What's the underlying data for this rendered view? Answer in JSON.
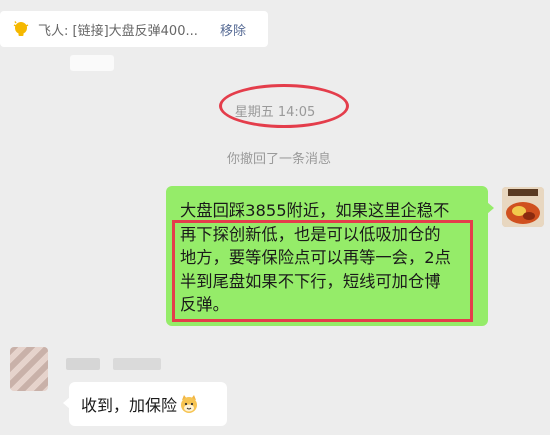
{
  "quote": {
    "icon": "lightbulb-icon",
    "text": "飞人: [链接]大盘反弹400...",
    "remove_label": "移除"
  },
  "timestamp": "星期五 14:05",
  "system_notice": "你撤回了一条消息",
  "messages": [
    {
      "side": "right",
      "text_lines": [
        "大盘回踩3855附近，如果这里企稳不",
        "再下探创新低，也是可以低吸加仓的",
        "地方，要等保险点可以再等一会，2点",
        "半到尾盘如果不下行，短线可加仓博",
        "反弹。"
      ]
    },
    {
      "side": "left",
      "text": "收到，加保险",
      "emoji": "cat-face-icon"
    }
  ],
  "colors": {
    "chat_bg": "#ededed",
    "my_bubble": "#95ec69",
    "other_bubble": "#ffffff",
    "annotation_red": "#e43d4b",
    "link_blue": "#576b95"
  }
}
